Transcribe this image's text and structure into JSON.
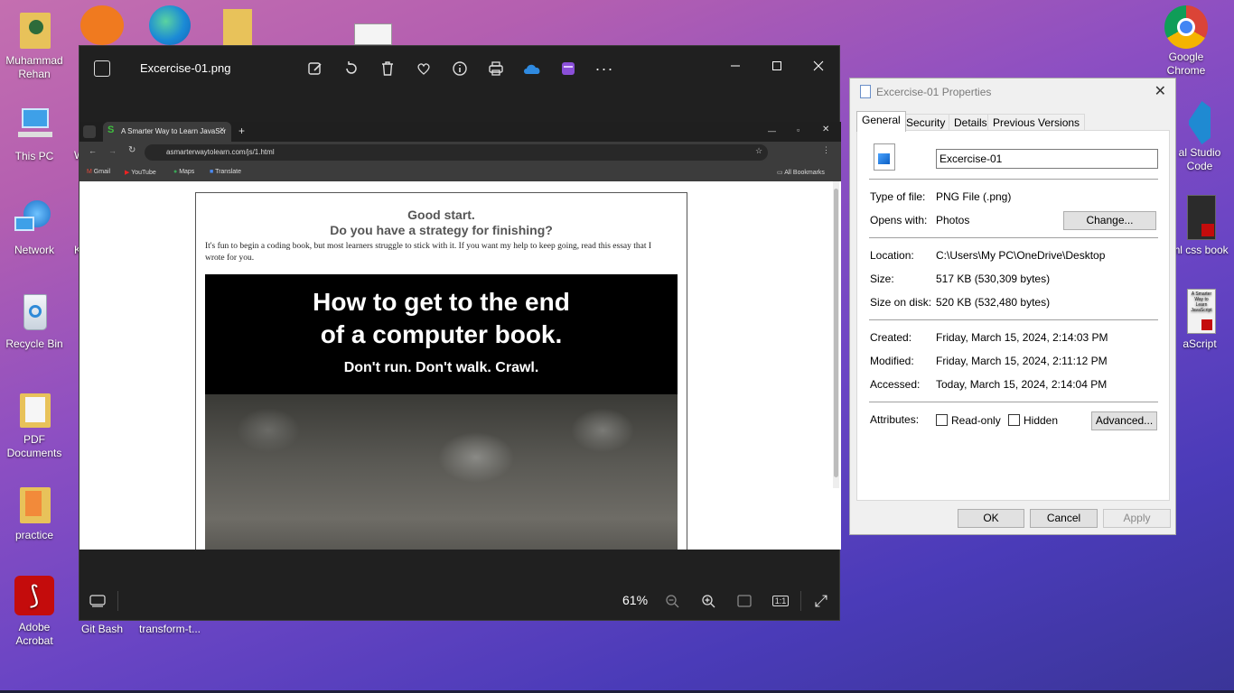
{
  "desktop": {
    "left_icons": [
      {
        "label": "Muhammad Rehan",
        "icon": "user-folder-icon"
      },
      {
        "label": "This PC",
        "icon": "computer-icon"
      },
      {
        "label": "Network",
        "icon": "network-icon"
      },
      {
        "label": "Recycle Bin",
        "icon": "recycle-bin-icon"
      },
      {
        "label": "PDF Documents",
        "icon": "folder-icon"
      },
      {
        "label": "practice",
        "icon": "folder-icon"
      },
      {
        "label": "Adobe Acrobat",
        "icon": "acrobat-icon"
      }
    ],
    "partial_labels": {
      "k": "K",
      "w": "W"
    },
    "bottom_labels": {
      "git": "Git Bash",
      "transform": "transform-t..."
    },
    "right_icons": [
      {
        "label": "Google Chrome",
        "icon": "chrome-icon"
      },
      {
        "label": "al Studio Code",
        "icon": "vscode-icon"
      },
      {
        "label": "ml css book",
        "icon": "pdf-book-icon"
      },
      {
        "label": "aScript",
        "icon": "pdf-book-icon"
      }
    ],
    "js_book_text": "A Smarter Way to Learn JavaScript"
  },
  "photos": {
    "title": "Excercise-01.png",
    "zoom": "61%",
    "tool_icons": [
      "edit-icon",
      "rotate-icon",
      "delete-icon",
      "favorite-icon",
      "info-icon",
      "print-icon",
      "onedrive-icon",
      "clipchamp-icon",
      "more-icon"
    ],
    "more_glyph": "···",
    "zoom_out_glyph": "−",
    "zoom_in_glyph": "+",
    "fit_glyph": "▭",
    "actual_glyph": "1:1",
    "fullscreen_glyph": "⤢"
  },
  "browser": {
    "tab_title": "A Smarter Way to Learn JavaScr",
    "tab_close": "×",
    "new_tab": "+",
    "url": "asmarterwaytolearn.com/js/1.html",
    "bookmarks": [
      "Gmail",
      "YouTube",
      "Maps",
      "Translate"
    ],
    "all_bookmarks": "All Bookmarks"
  },
  "page": {
    "heading_1": "Good start.",
    "heading_2": "Do you have a strategy for finishing?",
    "body": "It's fun to begin a coding book, but most learners struggle to stick with it. If you want my help to keep going, read this essay that I wrote for you.",
    "hero_line1": "How to get to the end",
    "hero_line2": "of a computer book.",
    "hero_line3": "Don't run. Don't walk. Crawl."
  },
  "properties": {
    "title": "Excercise-01 Properties",
    "close_glyph": "✕",
    "tabs": [
      "General",
      "Security",
      "Details",
      "Previous Versions"
    ],
    "file_name": "Excercise-01",
    "type_label": "Type of file:",
    "type_value": "PNG File (.png)",
    "opens_label": "Opens with:",
    "opens_value": "Photos",
    "change_button": "Change...",
    "location_label": "Location:",
    "location_value": "C:\\Users\\My PC\\OneDrive\\Desktop",
    "size_label": "Size:",
    "size_value": "517 KB (530,309 bytes)",
    "size_disk_label": "Size on disk:",
    "size_disk_value": "520 KB (532,480 bytes)",
    "created_label": "Created:",
    "created_value": "Friday, March 15, 2024, 2:14:03 PM",
    "modified_label": "Modified:",
    "modified_value": "Friday, March 15, 2024, 2:11:12 PM",
    "accessed_label": "Accessed:",
    "accessed_value": "Today, March 15, 2024, 2:14:04 PM",
    "attributes_label": "Attributes:",
    "readonly_label": "Read-only",
    "hidden_label": "Hidden",
    "advanced_button": "Advanced...",
    "ok_button": "OK",
    "cancel_button": "Cancel",
    "apply_button": "Apply"
  }
}
